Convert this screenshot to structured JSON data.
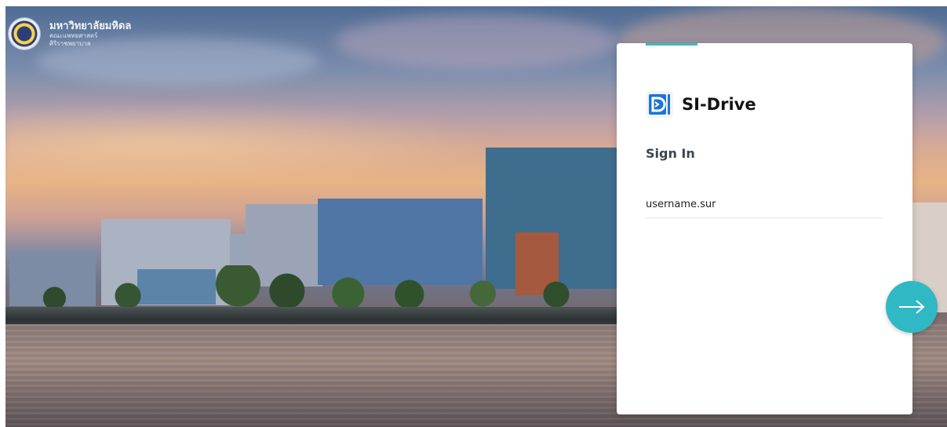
{
  "university": {
    "name": "มหาวิทยาลัยมหิดล",
    "faculty_line1": "คณะแพทยศาสตร์",
    "faculty_line2": "ศิริราชพยาบาล",
    "seal_icon": "university-seal-icon"
  },
  "login": {
    "app_name": "SI-Drive",
    "app_icon": "si-drive-logo-icon",
    "heading": "Sign In",
    "username_value": "username.sur",
    "next_icon": "arrow-right-icon"
  },
  "colors": {
    "accent": "#3ab8c3",
    "button": "#30b8c4",
    "logo_blue": "#1e73d8",
    "heading": "#3d4450"
  }
}
